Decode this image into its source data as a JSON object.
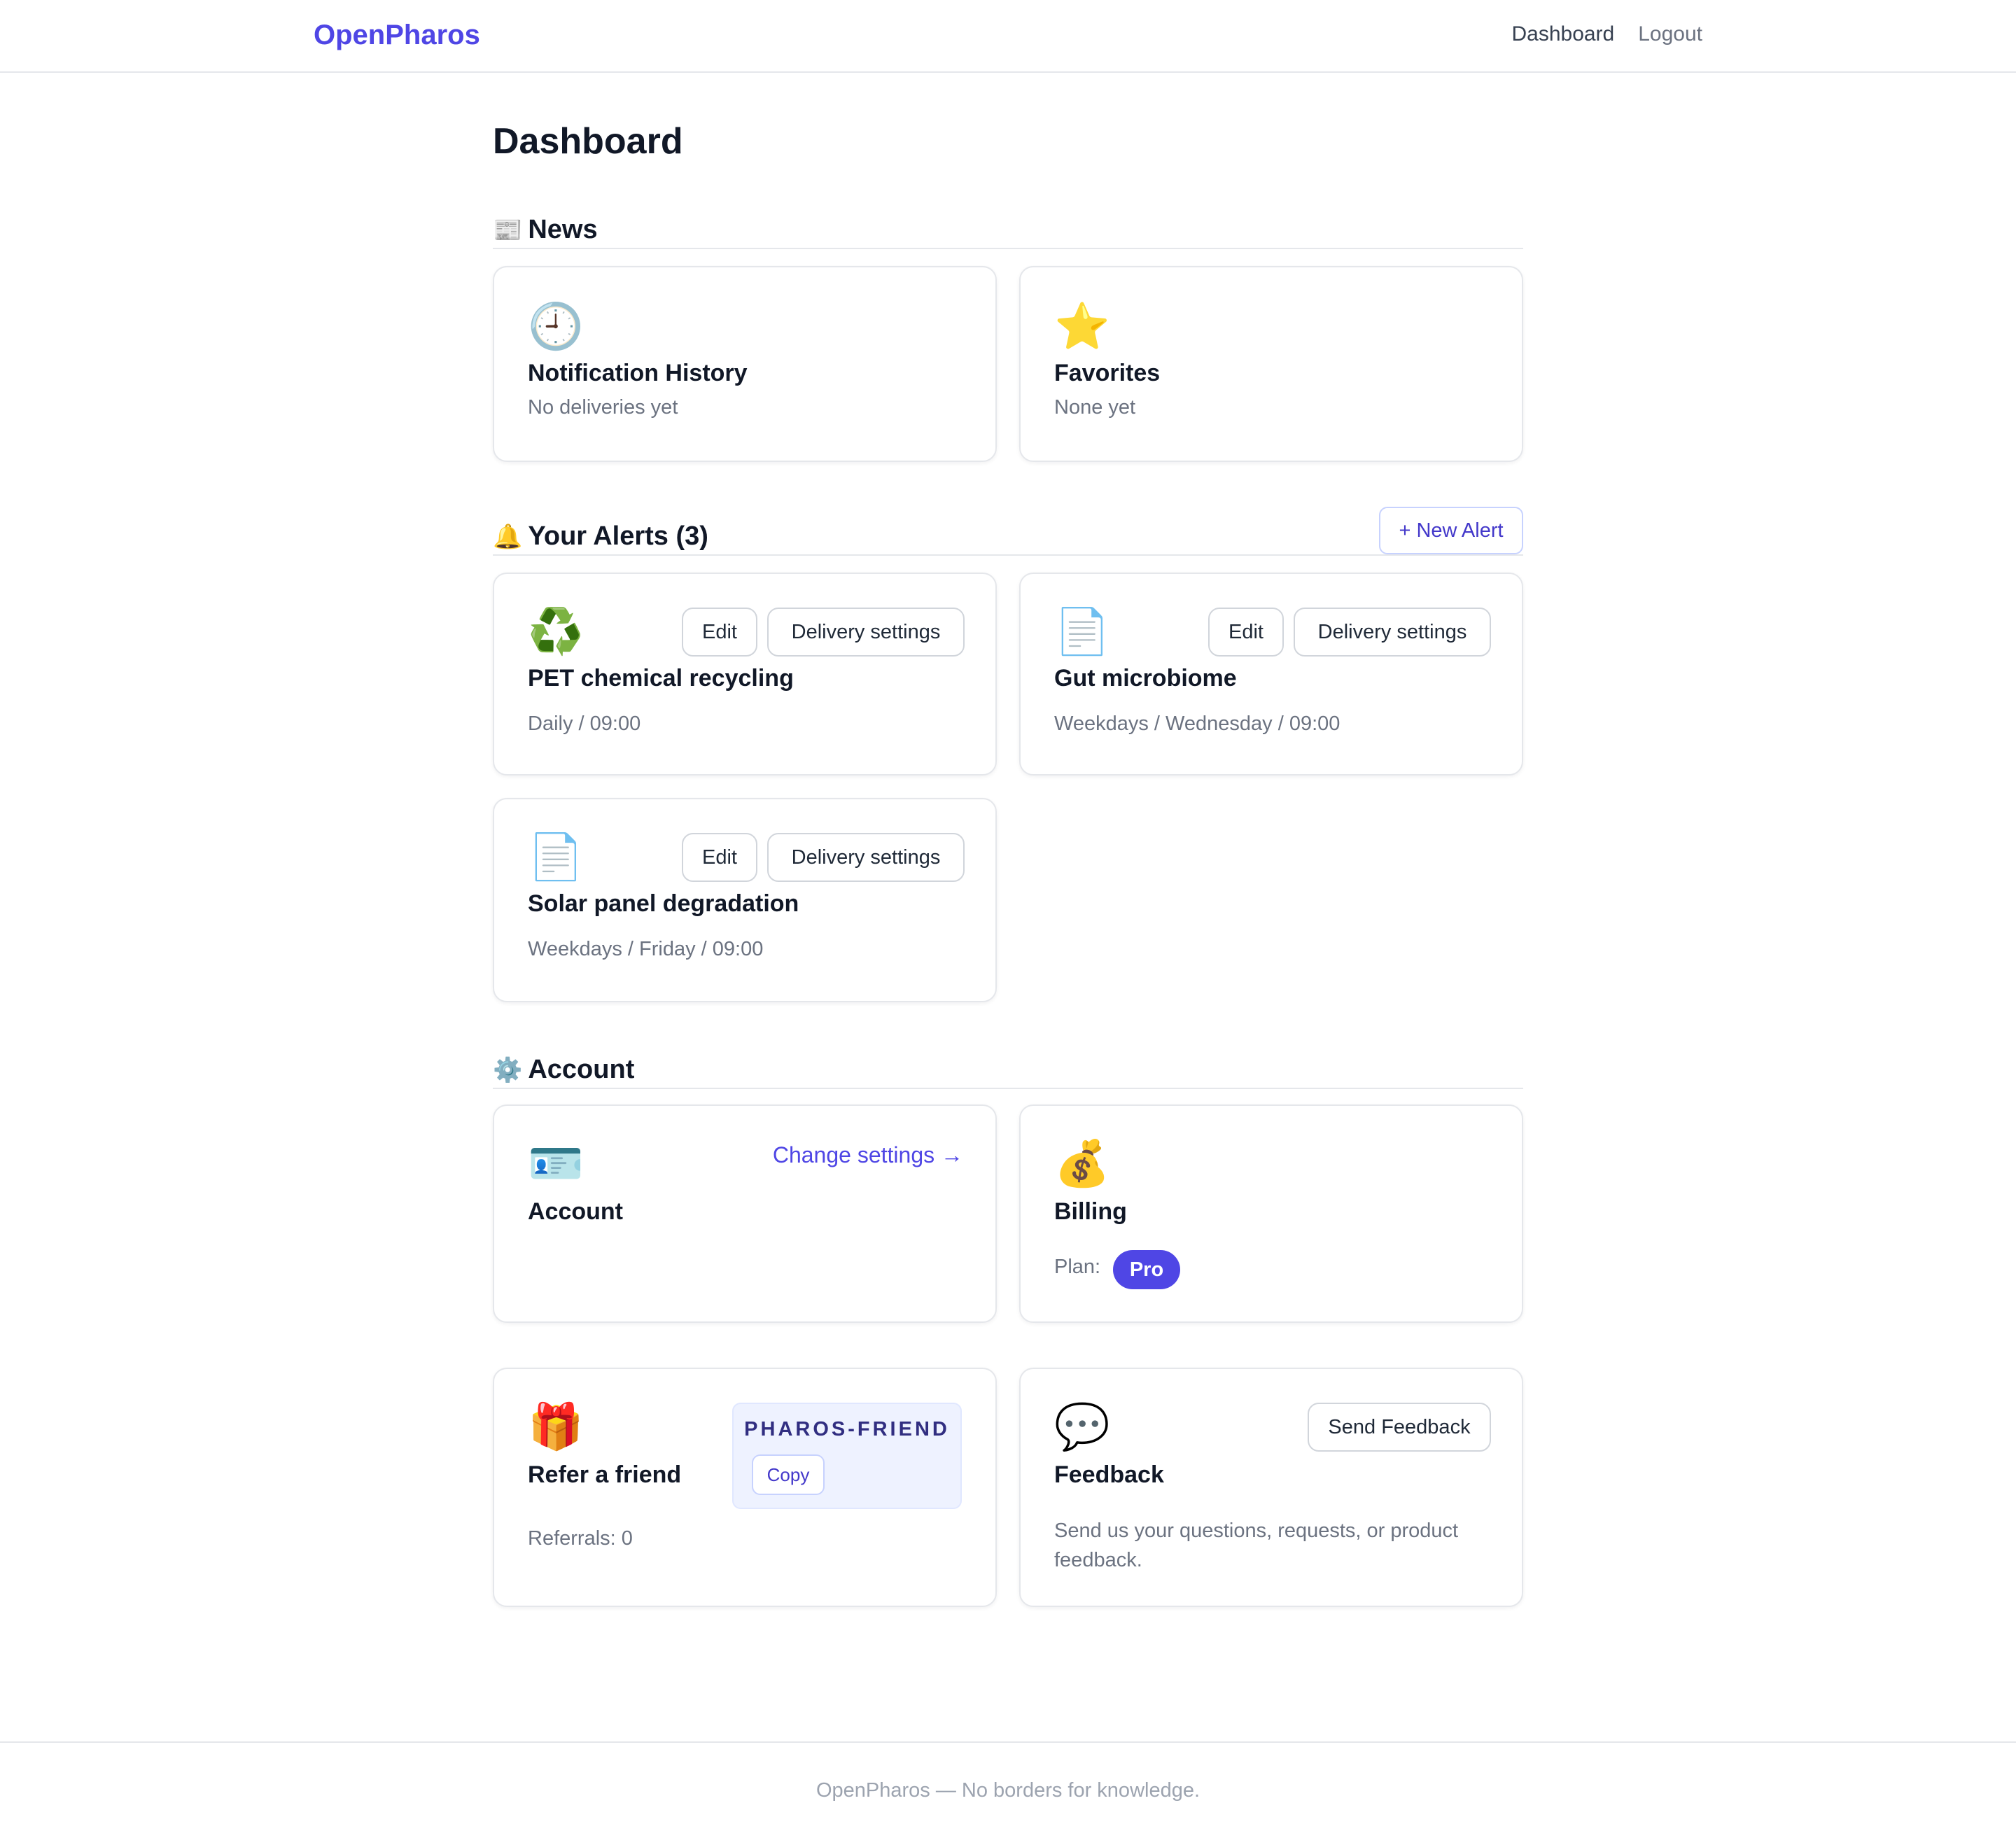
{
  "nav": {
    "brand": "OpenPharos",
    "links": [
      "Dashboard",
      "Logout"
    ]
  },
  "page": {
    "title": "Dashboard"
  },
  "news": {
    "icon": "newspaper-icon",
    "title": "News",
    "cards": [
      {
        "icon": "clock-icon",
        "title": "Notification History",
        "sub": "No deliveries yet"
      },
      {
        "icon": "star-icon",
        "title": "Favorites",
        "sub": "None yet"
      }
    ]
  },
  "alerts": {
    "icon": "bell-icon",
    "title": "Your Alerts (3)",
    "new_alert_label": "+ New Alert",
    "edit_label": "Edit",
    "delivery_label": "Delivery settings",
    "items": [
      {
        "icon": "recycle-icon",
        "title": "PET chemical recycling",
        "schedule": "Daily / 09:00"
      },
      {
        "icon": "document-icon",
        "title": "Gut microbiome",
        "schedule": "Weekdays / Wednesday / 09:00"
      },
      {
        "icon": "document-icon",
        "title": "Solar panel degradation",
        "schedule": "Weekdays / Friday / 09:00"
      }
    ]
  },
  "account": {
    "icon": "gear-icon",
    "title": "Account",
    "account_card": {
      "icon": "id-card-icon",
      "title": "Account",
      "link": "Change settings →"
    },
    "billing_card": {
      "icon": "money-bag-icon",
      "title": "Billing",
      "plan_label": "Plan:",
      "plan": "Pro"
    },
    "refer_card": {
      "icon": "gift-icon",
      "title": "Refer a friend",
      "code": "PHAROS-FRIEND",
      "copy_label": "Copy",
      "referrals": "Referrals: 0"
    },
    "feedback_card": {
      "icon": "speech-bubble-icon",
      "title": "Feedback",
      "button": "Send Feedback",
      "desc": "Send us your questions, requests, or product feedback."
    }
  },
  "footer": {
    "text": "OpenPharos — No borders for knowledge."
  },
  "colors": {
    "accent": "#4f46e5",
    "muted": "#6b7280",
    "border": "#e5e7eb"
  }
}
